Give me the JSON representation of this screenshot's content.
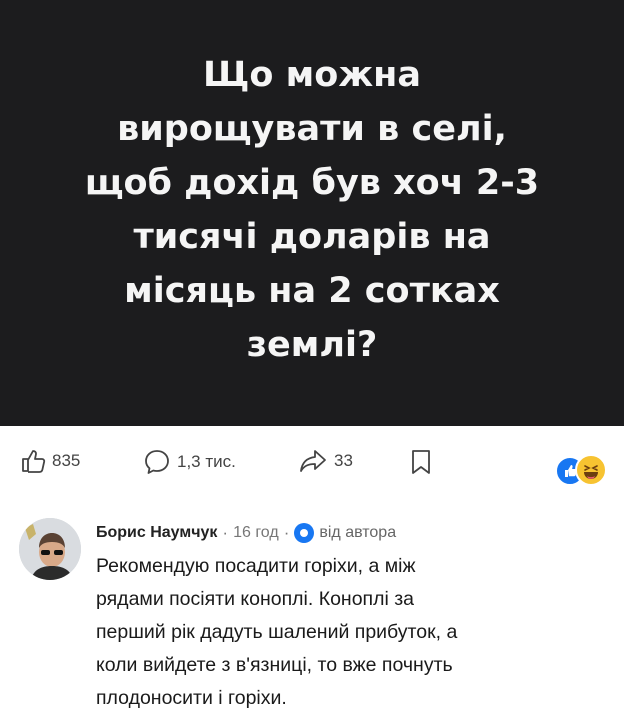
{
  "post": {
    "lines": [
      "Що можна",
      "вирощувати в селі,",
      "щоб дохід був хоч 2-3",
      "тисячі доларів на",
      "місяць на 2 сотках",
      "землі?"
    ]
  },
  "actions": {
    "likes": "835",
    "comments": "1,3 тис.",
    "shares": "33"
  },
  "comment": {
    "author": "Борис Наумчук",
    "age": "16 год",
    "separator": "·",
    "by_author": "від автора",
    "lines": [
      "Рекомендую посадити горіхи, а між",
      "рядами посіяти коноплі. Коноплі за",
      "перший рік дадуть шалений прибуток, а",
      "коли вийдете з в'язниці, то вже почнуть",
      "плодоносити і горіхи."
    ]
  },
  "colors": {
    "card_bg": "#1c1c1e",
    "accent": "#1877f2"
  }
}
